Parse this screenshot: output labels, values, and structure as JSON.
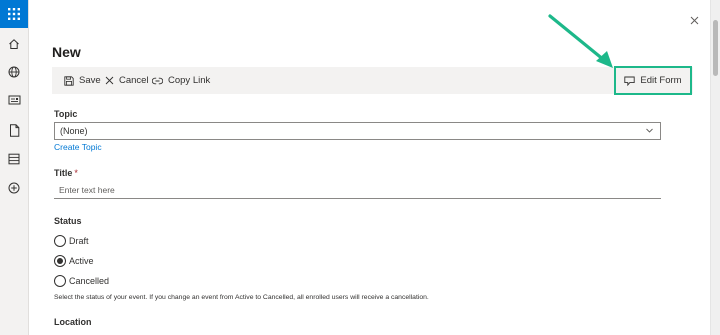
{
  "panel": {
    "title": "New",
    "close_icon": "close-icon"
  },
  "toolbar": {
    "save_label": "Save",
    "cancel_label": "Cancel",
    "copy_link_label": "Copy Link",
    "edit_form_label": "Edit Form",
    "highlight_color": "#1db88a"
  },
  "fields": {
    "topic": {
      "label": "Topic",
      "value": "(None)",
      "create_link": "Create Topic"
    },
    "title": {
      "label": "Title",
      "required_mark": "*",
      "placeholder": "Enter text here"
    },
    "status": {
      "label": "Status",
      "options": [
        {
          "label": "Draft",
          "selected": false
        },
        {
          "label": "Active",
          "selected": true
        },
        {
          "label": "Cancelled",
          "selected": false
        }
      ],
      "help": "Select the status of your event. If you change an event from Active to Cancelled, all enrolled users will receive a cancellation."
    },
    "location": {
      "label": "Location"
    }
  },
  "colors": {
    "accent": "#0078d4",
    "rail_bg": "#f3f2f1",
    "toolbar_bg": "#f3f2f1"
  }
}
